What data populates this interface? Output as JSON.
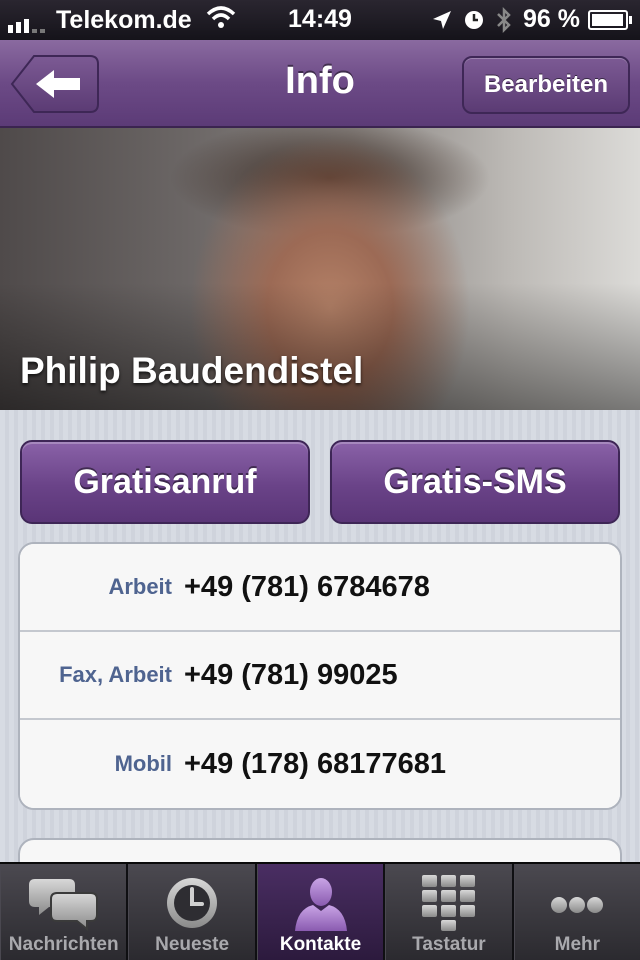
{
  "status_bar": {
    "carrier": "Telekom.de",
    "time": "14:49",
    "battery": "96 %",
    "battery_level": 0.96
  },
  "nav": {
    "title": "Info",
    "back_icon": "back-arrow-icon",
    "edit_label": "Bearbeiten"
  },
  "contact": {
    "name": "Philip Baudendistel"
  },
  "actions": {
    "call_label": "Gratisanruf",
    "sms_label": "Gratis-SMS"
  },
  "phones": [
    {
      "label": "Arbeit",
      "number": "+49 (781) 6784678"
    },
    {
      "label": "Fax, Arbeit",
      "number": "+49 (781) 99025"
    },
    {
      "label": "Mobil",
      "number": "+49 (178) 68177681"
    }
  ],
  "tabs": [
    {
      "label": "Nachrichten",
      "icon": "chat-bubbles-icon",
      "active": false
    },
    {
      "label": "Neueste",
      "icon": "clock-icon",
      "active": false
    },
    {
      "label": "Kontakte",
      "icon": "person-icon",
      "active": true
    },
    {
      "label": "Tastatur",
      "icon": "keypad-icon",
      "active": false
    },
    {
      "label": "Mehr",
      "icon": "more-dots-icon",
      "active": false
    }
  ],
  "colors": {
    "accent": "#6c4a86",
    "label_blue": "#4f6490"
  }
}
